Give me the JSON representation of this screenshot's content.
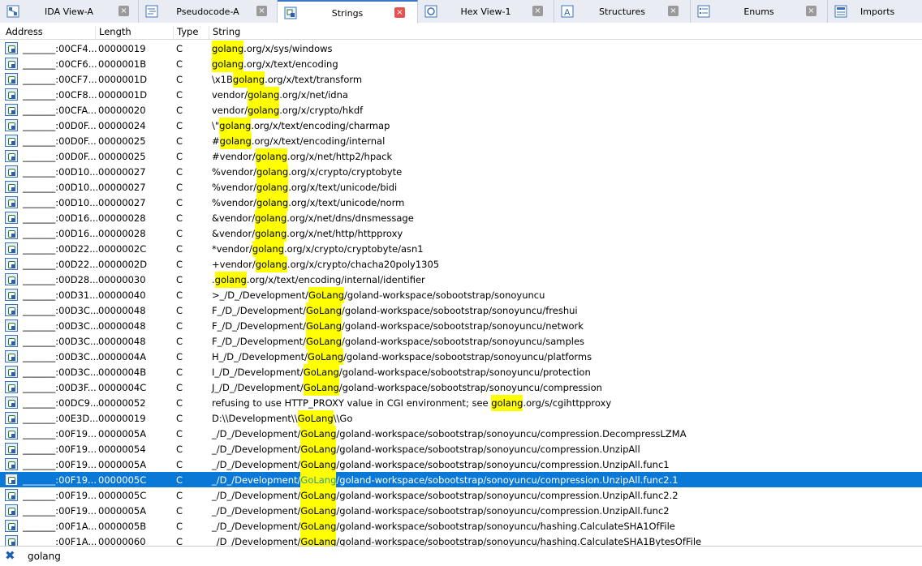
{
  "tabs": [
    {
      "label": "IDA View-A",
      "icon": "ida-view-icon"
    },
    {
      "label": "Pseudocode-A",
      "icon": "pseudocode-icon"
    },
    {
      "label": "Strings",
      "icon": "strings-icon",
      "active": true
    },
    {
      "label": "Hex View-1",
      "icon": "hex-view-icon"
    },
    {
      "label": "Structures",
      "icon": "structures-icon"
    },
    {
      "label": "Enums",
      "icon": "enums-icon"
    },
    {
      "label": "Imports",
      "icon": "imports-icon"
    }
  ],
  "close_glyph": "×",
  "columns": {
    "address": "Address",
    "length": "Length",
    "type": "Type",
    "string": "String"
  },
  "rows": [
    {
      "addr": "_______:00CF4...",
      "len": "00000019",
      "type": "C",
      "pre": "",
      "hl": "golang",
      "post": ".org/x/sys/windows"
    },
    {
      "addr": "_______:00CF6...",
      "len": "0000001B",
      "type": "C",
      "pre": "",
      "hl": "golang",
      "post": ".org/x/text/encoding"
    },
    {
      "addr": "_______:00CF7...",
      "len": "0000001D",
      "type": "C",
      "pre": "\\x1B",
      "hl": "golang",
      "post": ".org/x/text/transform"
    },
    {
      "addr": "_______:00CF8...",
      "len": "0000001D",
      "type": "C",
      "pre": "vendor/",
      "hl": "golang",
      "post": ".org/x/net/idna"
    },
    {
      "addr": "_______:00CFA...",
      "len": "00000020",
      "type": "C",
      "pre": "vendor/",
      "hl": "golang",
      "post": ".org/x/crypto/hkdf"
    },
    {
      "addr": "_______:00D0F...",
      "len": "00000024",
      "type": "C",
      "pre": "\\\"",
      "hl": "golang",
      "post": ".org/x/text/encoding/charmap"
    },
    {
      "addr": "_______:00D0F...",
      "len": "00000025",
      "type": "C",
      "pre": "#",
      "hl": "golang",
      "post": ".org/x/text/encoding/internal"
    },
    {
      "addr": "_______:00D0F...",
      "len": "00000025",
      "type": "C",
      "pre": "#vendor/",
      "hl": "golang",
      "post": ".org/x/net/http2/hpack"
    },
    {
      "addr": "_______:00D10...",
      "len": "00000027",
      "type": "C",
      "pre": "%vendor/",
      "hl": "golang",
      "post": ".org/x/crypto/cryptobyte"
    },
    {
      "addr": "_______:00D10...",
      "len": "00000027",
      "type": "C",
      "pre": "%vendor/",
      "hl": "golang",
      "post": ".org/x/text/unicode/bidi"
    },
    {
      "addr": "_______:00D10...",
      "len": "00000027",
      "type": "C",
      "pre": "%vendor/",
      "hl": "golang",
      "post": ".org/x/text/unicode/norm"
    },
    {
      "addr": "_______:00D16...",
      "len": "00000028",
      "type": "C",
      "pre": "&vendor/",
      "hl": "golang",
      "post": ".org/x/net/dns/dnsmessage"
    },
    {
      "addr": "_______:00D16...",
      "len": "00000028",
      "type": "C",
      "pre": "&vendor/",
      "hl": "golang",
      "post": ".org/x/net/http/httpproxy"
    },
    {
      "addr": "_______:00D22...",
      "len": "0000002C",
      "type": "C",
      "pre": "*vendor/",
      "hl": "golang",
      "post": ".org/x/crypto/cryptobyte/asn1"
    },
    {
      "addr": "_______:00D22...",
      "len": "0000002D",
      "type": "C",
      "pre": "+vendor/",
      "hl": "golang",
      "post": ".org/x/crypto/chacha20poly1305"
    },
    {
      "addr": "_______:00D28...",
      "len": "00000030",
      "type": "C",
      "pre": ".",
      "hl": "golang",
      "post": ".org/x/text/encoding/internal/identifier"
    },
    {
      "addr": "_______:00D31...",
      "len": "00000040",
      "type": "C",
      "pre": ">_/D_/Development/",
      "hl": "GoLang",
      "post": "/goland-workspace/sobootstrap/sonoyuncu"
    },
    {
      "addr": "_______:00D3C...",
      "len": "00000048",
      "type": "C",
      "pre": "F_/D_/Development/",
      "hl": "GoLang",
      "post": "/goland-workspace/sobootstrap/sonoyuncu/freshui"
    },
    {
      "addr": "_______:00D3C...",
      "len": "00000048",
      "type": "C",
      "pre": "F_/D_/Development/",
      "hl": "GoLang",
      "post": "/goland-workspace/sobootstrap/sonoyuncu/network"
    },
    {
      "addr": "_______:00D3C...",
      "len": "00000048",
      "type": "C",
      "pre": "F_/D_/Development/",
      "hl": "GoLang",
      "post": "/goland-workspace/sobootstrap/sonoyuncu/samples"
    },
    {
      "addr": "_______:00D3C...",
      "len": "0000004A",
      "type": "C",
      "pre": "H_/D_/Development/",
      "hl": "GoLang",
      "post": "/goland-workspace/sobootstrap/sonoyuncu/platforms"
    },
    {
      "addr": "_______:00D3C...",
      "len": "0000004B",
      "type": "C",
      "pre": "I_/D_/Development/",
      "hl": "GoLang",
      "post": "/goland-workspace/sobootstrap/sonoyuncu/protection"
    },
    {
      "addr": "_______:00D3F...",
      "len": "0000004C",
      "type": "C",
      "pre": "J_/D_/Development/",
      "hl": "GoLang",
      "post": "/goland-workspace/sobootstrap/sonoyuncu/compression"
    },
    {
      "addr": "_______:00DC9...",
      "len": "00000052",
      "type": "C",
      "pre": "refusing to use HTTP_PROXY value in CGI environment; see ",
      "hl": "golang",
      "post": ".org/s/cgihttpproxy"
    },
    {
      "addr": "_______:00E3D...",
      "len": "00000019",
      "type": "C",
      "pre": "D:\\\\Development\\\\",
      "hl": "GoLang",
      "post": "\\\\Go"
    },
    {
      "addr": "_______:00F19...",
      "len": "0000005A",
      "type": "C",
      "pre": "_/D_/Development/",
      "hl": "GoLang",
      "post": "/goland-workspace/sobootstrap/sonoyuncu/compression.DecompressLZMA"
    },
    {
      "addr": "_______:00F19...",
      "len": "00000054",
      "type": "C",
      "pre": "_/D_/Development/",
      "hl": "GoLang",
      "post": "/goland-workspace/sobootstrap/sonoyuncu/compression.UnzipAll"
    },
    {
      "addr": "_______:00F19...",
      "len": "0000005A",
      "type": "C",
      "pre": "_/D_/Development/",
      "hl": "GoLang",
      "post": "/goland-workspace/sobootstrap/sonoyuncu/compression.UnzipAll.func1"
    },
    {
      "addr": "_______:00F19...",
      "len": "0000005C",
      "type": "C",
      "pre": "_/D_/Development/",
      "hl": "GoLang",
      "post": "/goland-workspace/sobootstrap/sonoyuncu/compression.UnzipAll.func2.1",
      "selected": true
    },
    {
      "addr": "_______:00F19...",
      "len": "0000005C",
      "type": "C",
      "pre": "_/D_/Development/",
      "hl": "GoLang",
      "post": "/goland-workspace/sobootstrap/sonoyuncu/compression.UnzipAll.func2.2"
    },
    {
      "addr": "_______:00F19...",
      "len": "0000005A",
      "type": "C",
      "pre": "_/D_/Development/",
      "hl": "GoLang",
      "post": "/goland-workspace/sobootstrap/sonoyuncu/compression.UnzipAll.func2"
    },
    {
      "addr": "_______:00F1A...",
      "len": "0000005B",
      "type": "C",
      "pre": "_/D_/Development/",
      "hl": "GoLang",
      "post": "/goland-workspace/sobootstrap/sonoyuncu/hashing.CalculateSHA1OfFile"
    },
    {
      "addr": "_______:00F1A...",
      "len": "00000060",
      "type": "C",
      "pre": "_/D_/Development/",
      "hl": "GoLang",
      "post": "/goland-workspace/sobootstrap/sonoyuncu/hashing.CalculateSHA1BytesOfFile"
    }
  ],
  "filter": {
    "icon": "close-filter-icon",
    "glyph": "✖",
    "text": "golang"
  },
  "colors": {
    "selection": "#0a78d7",
    "highlight": "#ffff00",
    "active_tab_close": "#e55353"
  }
}
